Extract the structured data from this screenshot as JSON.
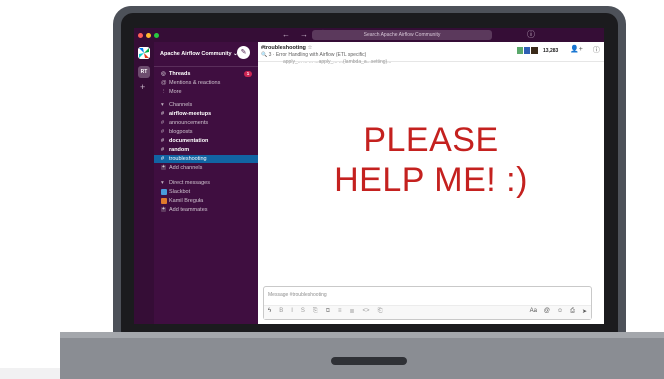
{
  "window": {
    "search_placeholder": "Search Apache Airflow Community",
    "nav_back": "←",
    "nav_forward": "→",
    "history": "🕘",
    "help": "ⓘ"
  },
  "rail": {
    "ws_initials": "RT",
    "add": "+"
  },
  "sidebar": {
    "workspace_name": "Apache Airflow Community ⌄",
    "compose": "✎",
    "threads": {
      "icon": "◎",
      "label": "Threads",
      "badge": "1"
    },
    "mentions": {
      "icon": "@",
      "label": "Mentions & reactions"
    },
    "more": {
      "icon": "⋮",
      "label": "More"
    },
    "channels_header": "Channels",
    "channels": [
      {
        "label": "airflow-meetups",
        "bold": true
      },
      {
        "label": "announcements",
        "bold": false
      },
      {
        "label": "blogposts",
        "bold": false
      },
      {
        "label": "documentation",
        "bold": true
      },
      {
        "label": "random",
        "bold": true
      },
      {
        "label": "troubleshooting",
        "bold": false,
        "active": true
      }
    ],
    "add_channels": "Add channels",
    "dm_header": "Direct messages",
    "dms": [
      {
        "label": "Slackbot",
        "color": "#4a9bd9"
      },
      {
        "label": "Kamil Breguła",
        "color": "#e07a2b"
      }
    ],
    "add_teammates": "Add teammates"
  },
  "channel": {
    "title": "#troubleshooting",
    "star": "☆",
    "topic": "🔍 3 · Error Handling with Airflow (ETL specific)",
    "member_count": "13,283",
    "header_icons": [
      "👤+",
      "ⓘ"
    ],
    "cut_text": "apply_... ... ... ...apply_... ...(lambda_a...setting)..."
  },
  "message": {
    "line1": "PLEASE",
    "line2": "HELP ME! :)",
    "color": "#c4211f"
  },
  "composer": {
    "placeholder": "Message #troubleshooting",
    "tools": [
      "ϟ",
      "B",
      "I",
      "S",
      "⎘",
      "⧉",
      "≡",
      "≣",
      "<>",
      "⎗"
    ],
    "right_tools": [
      "Aa",
      "@",
      "☺",
      "⎙",
      "➤"
    ]
  },
  "colors": {
    "sidebar": "#3f0e40",
    "rail": "#350d36",
    "active": "#1164a3",
    "badge": "#cd2553"
  }
}
